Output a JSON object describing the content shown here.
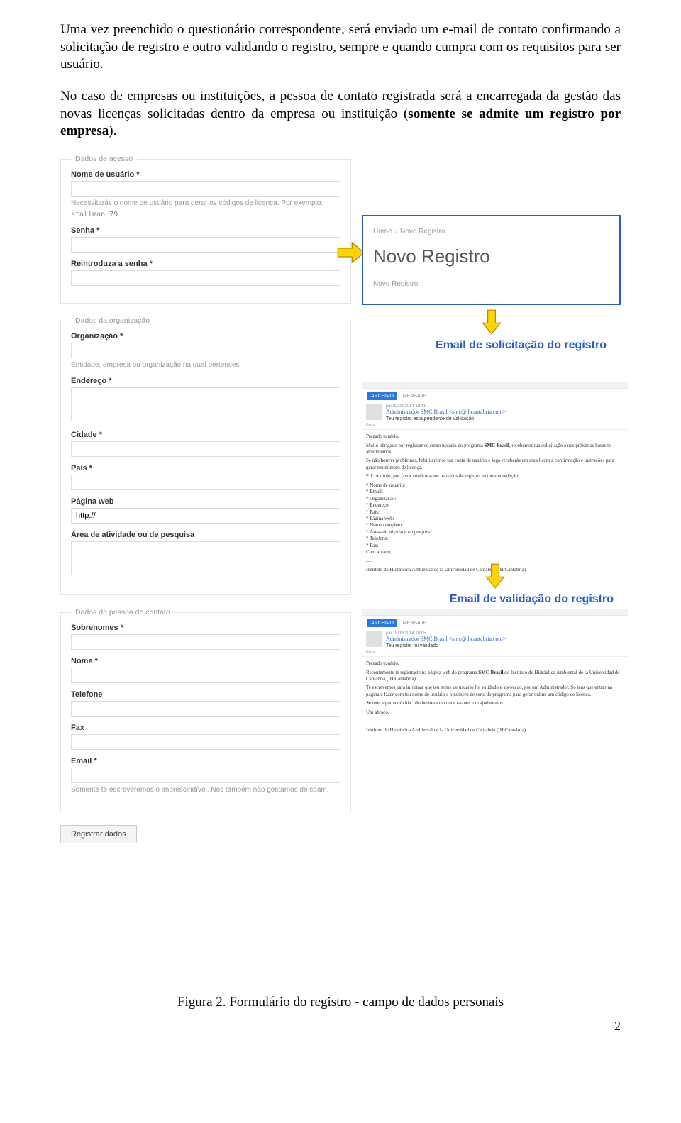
{
  "paragraph1": "Uma vez preenchido o questionário correspondente, será enviado um e-mail de contato confirmando a solicitação de registro e outro validando o registro, sempre e quando cumpra com os requisitos para ser usuário.",
  "paragraph2_a": "No caso de empresas ou instituições, a pessoa de contato registrada será a encarregada da gestão das novas licenças solicitadas dentro da empresa ou instituição (",
  "paragraph2_b": "somente se admite um registro por empresa",
  "paragraph2_c": ").",
  "form": {
    "legend_access": "Dados de acesso",
    "username_label": "Nome de usuário *",
    "username_help": "Necessitarás o nome de usuário para gerar os códigos de licença. Por exemplo:",
    "username_example": "stallman_79",
    "senha_label": "Senha *",
    "senha2_label": "Reintroduza a senha *",
    "legend_org": "Dados da organização",
    "org_label": "Organização *",
    "org_help": "Entidade, empresa ou organização na qual pertences",
    "endereco_label": "Endereço *",
    "cidade_label": "Cidade *",
    "pais_label": "País *",
    "pagina_label": "Página web",
    "pagina_value": "http://",
    "area_label": "Área de atividade ou de pesquisa",
    "legend_contact": "Dados da pessoa de contato",
    "sobrenomes_label": "Sobrenomes *",
    "nome_label": "Nome *",
    "telefone_label": "Telefone",
    "fax_label": "Fax",
    "email_label": "Email *",
    "email_help": "Somente te escreveremos o imprescindível. Nós também não gostamos de spam.",
    "submit": "Registrar dados"
  },
  "novo": {
    "home": "Home",
    "crumb": "Novo Registro",
    "title": "Novo Registro",
    "sub": "Novo Registro..."
  },
  "heading1": "Email de solicitação do registro",
  "heading2": "Email de validação do registro",
  "email1": {
    "badge": "ARCHIVO",
    "tab": "MENSAJE",
    "date": "jue 02/09/2014 18:41",
    "from": "Administrador SMC Brasil <smc@ihcantabria.com>",
    "subject": "Teu registro está pendente de validação",
    "para": "Para",
    "l1": "Prezado usuário,",
    "l2_a": "Muito obrigado por registrar-se como usuário do programa ",
    "l2_b": "SMC Brasil",
    "l2_c": ", recebemos tua solicitação e nos próximas horas te atenderemos.",
    "l3": "Se não houver problemas, habilitaremos tua conta de usuário e logo receberás um email com a confirmação e instruções para gerar teu número de licença.",
    "l4": "P.d.: A título, por favor confirma-nos os dados de registro na mesma redeção:",
    "li1": "Nome de usuário:",
    "li2": "Email:",
    "li3": "Organização:",
    "li4": "Endereço:",
    "li5": "País:",
    "li6": "Página web:",
    "li7": "Nome completo:",
    "li8": "Áreas de atividade ou pesquisa:",
    "li9": "Telefone:",
    "li10": "Fax:",
    "close": "Com abraço,",
    "sign": "Instituto de Hidráulica Ambiental de la Universidad de Cantabria (IH Cantabria)"
  },
  "email2": {
    "badge": "ARCHIVO",
    "tab": "MENSAJE",
    "date": "jue 18/09/2014 10:05",
    "from": "Administrador SMC Brasil <smc@ihcantabria.com>",
    "subject": "Teu registro foi validado",
    "para": "Para",
    "l1": "Prezado usuário,",
    "l2_a": "Recentemente te registraste na página web do programa ",
    "l2_b": "SMC Brasil",
    "l2_c": " do Instituto de Hidráulica Ambiental de la Universidad de Cantabria (IH Cantabria).",
    "l3": "Te escrevemos para informar que teu nome de usuário foi validado e aprovado, por um Administrador. Só tens que entrar na página e fazer com teu nome de usuário e o número de serie do programa para gerar online um código de licença.",
    "l4": "Se tens alguma dúvida, não hesites em contactar-nos e te ajudaremos.",
    "close": "Um abraço,",
    "sign": "Instituto de Hidráulica Ambiental de la Universidad de Cantabria (IH Cantabria)"
  },
  "caption": "Figura 2. Formulário do registro - campo de dados personais",
  "page": "2"
}
